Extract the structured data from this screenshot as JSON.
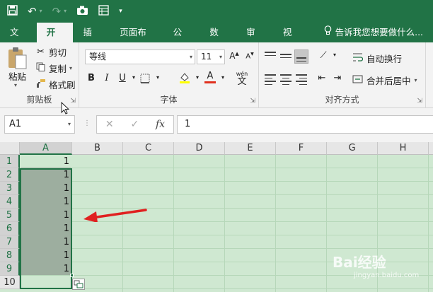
{
  "ribbon_tabs": [
    "文件",
    "开始",
    "插入",
    "页面布局",
    "公式",
    "数据",
    "审阅",
    "视图"
  ],
  "tell_me": "告诉我您想要做什么...",
  "clipboard": {
    "paste": "粘贴",
    "cut": "剪切",
    "copy": "复制",
    "format_painter": "格式刷",
    "label": "剪贴板"
  },
  "font": {
    "name": "等线",
    "size": "11",
    "bold": "B",
    "italic": "I",
    "underline": "U",
    "font_color_letter": "A",
    "wen": "wén",
    "label": "字体"
  },
  "alignment": {
    "wrap_text": "自动换行",
    "merge_center": "合并后居中",
    "label": "对齐方式"
  },
  "colors": {
    "excel_green": "#217346",
    "grid_bg": "#cfe8d1",
    "selection_shade": "#9dae9f",
    "highlight_yellow": "#ffff00",
    "font_red": "#e0301e",
    "arrow_red": "#e02020"
  },
  "formula_bar": {
    "name_box": "A1",
    "fx": "fx",
    "cancel": "✕",
    "confirm": "✓",
    "value": "1"
  },
  "grid": {
    "columns": [
      "A",
      "B",
      "C",
      "D",
      "E",
      "F",
      "G",
      "H"
    ],
    "rows": [
      "1",
      "2",
      "3",
      "4",
      "5",
      "6",
      "7",
      "8",
      "9",
      "10"
    ],
    "column_a_values": [
      "1",
      "1",
      "1",
      "1",
      "1",
      "1",
      "1",
      "1",
      "1",
      ""
    ]
  },
  "watermark": {
    "brand": "Bai经验",
    "site": "jingyan.baidu.com"
  }
}
